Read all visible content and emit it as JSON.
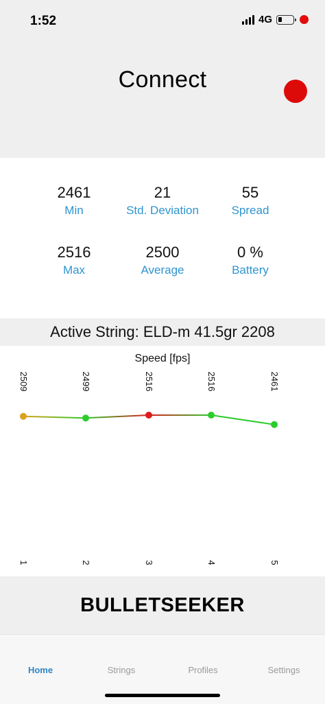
{
  "status": {
    "time": "1:52",
    "network": "4G"
  },
  "header": {
    "title": "Connect",
    "record_color": "#dd0a0a"
  },
  "stats": [
    {
      "value": "2461",
      "label": "Min"
    },
    {
      "value": "21",
      "label": "Std. Deviation"
    },
    {
      "value": "55",
      "label": "Spread"
    },
    {
      "value": "2516",
      "label": "Max"
    },
    {
      "value": "2500",
      "label": "Average"
    },
    {
      "value": "0 %",
      "label": "Battery"
    }
  ],
  "active_string": "Active String: ELD-m 41.5gr 2208",
  "chart_data": {
    "type": "line",
    "title": "Speed [fps]",
    "x": [
      "1",
      "2",
      "3",
      "4",
      "5"
    ],
    "values": [
      2509,
      2499,
      2516,
      2516,
      2461
    ],
    "point_colors": [
      "#d9a21a",
      "#2bcc2b",
      "#dd1b1b",
      "#2bcc2b",
      "#2bcc2b"
    ],
    "grid": false,
    "legend": "none"
  },
  "brand": "BULLETSEEKER",
  "tabs": [
    {
      "label": "Home",
      "active": true
    },
    {
      "label": "Strings",
      "active": false
    },
    {
      "label": "Profiles",
      "active": false
    },
    {
      "label": "Settings",
      "active": false
    }
  ]
}
